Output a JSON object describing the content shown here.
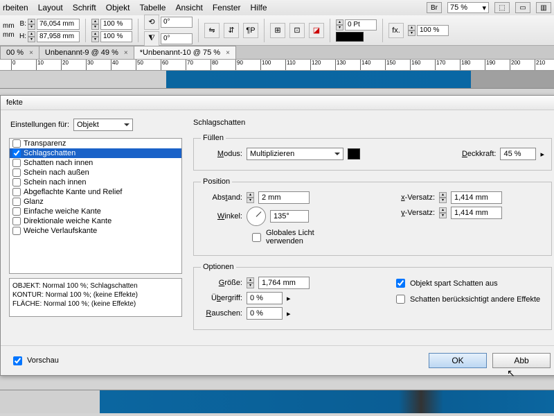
{
  "menu": {
    "items": [
      "rbeiten",
      "Layout",
      "Schrift",
      "Objekt",
      "Tabelle",
      "Ansicht",
      "Fenster",
      "Hilfe"
    ],
    "br": "Br",
    "zoom": "75 %",
    "tri": "▾"
  },
  "toolbar": {
    "a_lbl": "mm",
    "a_val": "",
    "b_lbl": "B:",
    "b_val": "76,054 mm",
    "h_lbl": "H:",
    "h_val": "87,958 mm",
    "sx": "100 %",
    "sy": "100 %",
    "rot": "0°",
    "shear": "0°",
    "stroke": "0 Pt",
    "fxpct": "100 %",
    "p": "¶P",
    "fx": "fx."
  },
  "tabs": [
    {
      "label": "00 %",
      "x": "×"
    },
    {
      "label": "Unbenannt-9 @ 49 %",
      "x": "×"
    },
    {
      "label": "*Unbenannt-10 @ 75 %",
      "x": "×",
      "active": true
    }
  ],
  "ruler_ticks": [
    0,
    10,
    20,
    30,
    40,
    50,
    60,
    70,
    80,
    90,
    100,
    110,
    120,
    130,
    140,
    150,
    160,
    170,
    180,
    190,
    200,
    210
  ],
  "dialog": {
    "title": "fekte",
    "settings_for": "Einstellungen für:",
    "settings_val": "Objekt",
    "effects": [
      {
        "label": "Transparenz",
        "checked": false,
        "sel": false
      },
      {
        "label": "Schlagschatten",
        "checked": true,
        "sel": true
      },
      {
        "label": "Schatten nach innen",
        "checked": false
      },
      {
        "label": "Schein nach außen",
        "checked": false
      },
      {
        "label": "Schein nach innen",
        "checked": false
      },
      {
        "label": "Abgeflachte Kante und Relief",
        "checked": false
      },
      {
        "label": "Glanz",
        "checked": false
      },
      {
        "label": "Einfache weiche Kante",
        "checked": false
      },
      {
        "label": "Direktionale weiche Kante",
        "checked": false
      },
      {
        "label": "Weiche Verlaufskante",
        "checked": false
      }
    ],
    "status": [
      "OBJEKT: Normal 100 %; Schlagschatten",
      "KONTUR: Normal 100 %; (keine Effekte)",
      "FLÄCHE: Normal 100 %; (keine Effekte)"
    ],
    "section_title": "Schlagschatten",
    "fill": {
      "legend": "Füllen",
      "mode_lbl": "Modus:",
      "mode_val": "Multiplizieren",
      "opacity_lbl": "Deckkraft:",
      "opacity_val": "45 %"
    },
    "pos": {
      "legend": "Position",
      "dist_lbl": "Abstand:",
      "dist_val": "2 mm",
      "angle_lbl": "Winkel:",
      "angle_val": "135°",
      "global": "Globales Licht verwenden",
      "xoff_lbl": "x-Versatz:",
      "xoff_val": "1,414 mm",
      "yoff_lbl": "y-Versatz:",
      "yoff_val": "1,414 mm"
    },
    "opt": {
      "legend": "Optionen",
      "size_lbl": "Größe:",
      "size_val": "1,764 mm",
      "spread_lbl": "Übergriff:",
      "spread_val": "0 %",
      "noise_lbl": "Rauschen:",
      "noise_val": "0 %",
      "knock": "Objekt spart Schatten aus",
      "honors": "Schatten berücksichtigt andere Effekte"
    },
    "preview": "Vorschau",
    "ok": "OK",
    "cancel": "Abb"
  }
}
